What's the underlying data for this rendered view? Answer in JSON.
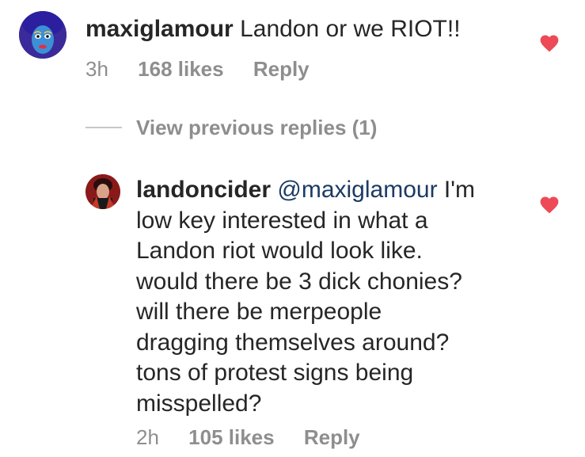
{
  "comment": {
    "username": "maxiglamour",
    "text": " Landon or we RIOT!!",
    "time": "3h",
    "likes": "168 likes",
    "reply_label": "Reply",
    "liked": true,
    "avatar_icon": "drag-queen-avatar"
  },
  "view_previous_replies": "View previous replies (1)",
  "reply": {
    "username": "landoncider",
    "mention": "@maxiglamour",
    "lines": [
      " I'm",
      "low key interested in what a",
      "Landon riot would look like.",
      "would there be 3 dick chonies?",
      "will there be merpeople",
      "dragging themselves around?",
      "tons of protest signs being",
      "misspelled?"
    ],
    "time": "2h",
    "likes": "105 likes",
    "reply_label": "Reply",
    "liked": true,
    "avatar_icon": "drag-king-avatar"
  },
  "colors": {
    "text": "#262626",
    "meta": "#8e8e8e",
    "heart": "#ed4956",
    "mention": "#1b3b63"
  }
}
